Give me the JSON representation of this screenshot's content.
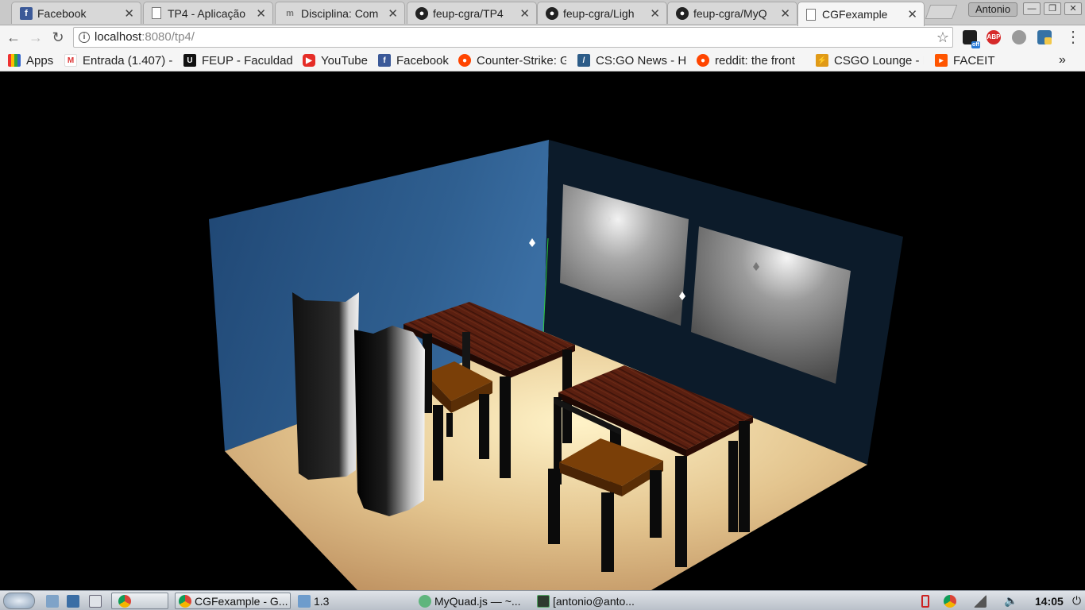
{
  "tabs": [
    {
      "title": "Facebook",
      "icon": "facebook-icon"
    },
    {
      "title": "TP4 - Aplicação",
      "icon": "document-icon"
    },
    {
      "title": "Disciplina: Com",
      "icon": "moodle-icon"
    },
    {
      "title": "feup-cgra/TP4",
      "icon": "github-icon"
    },
    {
      "title": "feup-cgra/Ligh",
      "icon": "github-icon"
    },
    {
      "title": "feup-cgra/MyQ",
      "icon": "github-icon"
    },
    {
      "title": "CGFexample",
      "icon": "document-icon",
      "active": true
    }
  ],
  "window": {
    "user": "Antonio",
    "minimize": "—",
    "restore": "❐",
    "close": "✕"
  },
  "address": {
    "host": "localhost",
    "rest": ":8080/tp4/"
  },
  "bookmarks": [
    {
      "label": "Apps",
      "icon": "apps-grid-icon"
    },
    {
      "label": "Entrada (1.407) -",
      "icon": "gmail-icon"
    },
    {
      "label": "FEUP - Faculdade",
      "icon": "feup-icon"
    },
    {
      "label": "YouTube",
      "icon": "youtube-icon"
    },
    {
      "label": "Facebook",
      "icon": "facebook-icon"
    },
    {
      "label": "Counter-Strike: G",
      "icon": "reddit-icon"
    },
    {
      "label": "CS:GO News - HL",
      "icon": "hltv-icon"
    },
    {
      "label": "reddit: the front",
      "icon": "reddit-icon"
    },
    {
      "label": "CSGO Lounge - M",
      "icon": "csgolounge-icon"
    },
    {
      "label": "FACEIT",
      "icon": "faceit-icon"
    }
  ],
  "bookmarks_more": "»",
  "extensions": [
    {
      "name": "mail-off-icon",
      "label": "off",
      "color": "#1e1e1e"
    },
    {
      "name": "adblock-icon",
      "label": "ABP",
      "color": "#d62a2a"
    },
    {
      "name": "profile-ghost-icon",
      "label": "",
      "color": "#9a9a9a"
    },
    {
      "name": "python-icon",
      "label": "",
      "color": "#3572a5"
    }
  ],
  "taskbar": {
    "items": [
      {
        "label": "CGFexample - G...",
        "icon": "chrome-icon"
      },
      {
        "label": "1.3",
        "icon": "folder-icon"
      },
      {
        "label": "MyQuad.js — ~...",
        "icon": "atom-icon"
      },
      {
        "label": "[antonio@anto...",
        "icon": "terminal-icon"
      }
    ],
    "clock": "14:05"
  },
  "colors": {
    "back_wall": "#2f5f90",
    "side_wall": "#0c1b2a",
    "floor": "#d6b27a",
    "table_top": "#5a1f10",
    "chair_seat": "#7a3f08",
    "frame": "#0b0b0b"
  }
}
